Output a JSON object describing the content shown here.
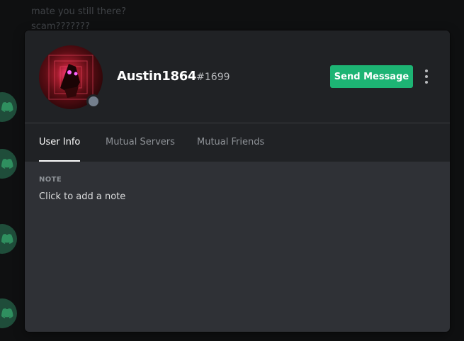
{
  "background_chat": {
    "lines": [
      "mate you still there?",
      "scam???????"
    ]
  },
  "profile": {
    "username": "Austin1864",
    "discriminator": "#1699",
    "status": "offline",
    "send_message_label": "Send Message",
    "more_icon": "more-vertical-icon"
  },
  "tabs": [
    {
      "label": "User Info",
      "active": true
    },
    {
      "label": "Mutual Servers",
      "active": false
    },
    {
      "label": "Mutual Friends",
      "active": false
    }
  ],
  "note": {
    "title": "NOTE",
    "placeholder": "Click to add a note"
  },
  "colors": {
    "accent": "#1db474",
    "modal_bg": "#2f3136",
    "header_bg": "#202225",
    "status_offline": "#747f8d"
  }
}
